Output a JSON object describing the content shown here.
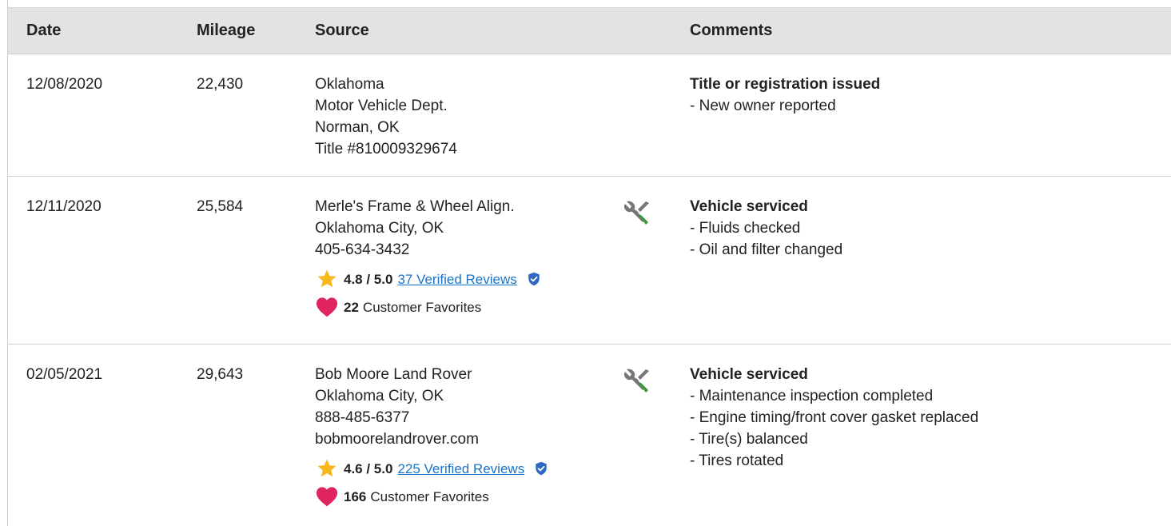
{
  "header": {
    "date": "Date",
    "mileage": "Mileage",
    "source": "Source",
    "comments": "Comments"
  },
  "rows": [
    {
      "date": "12/08/2020",
      "mileage": "22,430",
      "source": [
        "Oklahoma",
        "Motor Vehicle Dept.",
        "Norman, OK",
        "Title #810009329674"
      ],
      "comment_title": "Title or registration issued",
      "comments": [
        "- New owner reported"
      ]
    },
    {
      "date": "12/11/2020",
      "mileage": "25,584",
      "source": [
        "Merle's Frame & Wheel Align.",
        "Oklahoma City, OK",
        "405-634-3432"
      ],
      "rating": {
        "score": "4.8 / 5.0",
        "reviews_link": "37 Verified Reviews"
      },
      "favorites": {
        "count": "22",
        "label": "Customer Favorites"
      },
      "service_icon": "wrench-screwdriver-icon",
      "comment_title": "Vehicle serviced",
      "comments": [
        "- Fluids checked",
        "- Oil and filter changed"
      ]
    },
    {
      "date": "02/05/2021",
      "mileage": "29,643",
      "source": [
        "Bob Moore Land Rover",
        "Oklahoma City, OK",
        "888-485-6377",
        "bobmoorelandrover.com"
      ],
      "rating": {
        "score": "4.6 / 5.0",
        "reviews_link": "225 Verified Reviews"
      },
      "favorites": {
        "count": "166",
        "label": "Customer Favorites"
      },
      "service_icon": "wrench-screwdriver-icon",
      "comment_title": "Vehicle serviced",
      "comments": [
        "- Maintenance inspection completed",
        "- Engine timing/front cover gasket replaced",
        "- Tire(s) balanced",
        "- Tires rotated"
      ]
    }
  ],
  "colors": {
    "header_bg": "#e3e3e3",
    "link": "#1a73c9",
    "star": "#f6b81a",
    "heart": "#e0245e",
    "verified": "#2f67c4",
    "wrench_gray": "#777777",
    "screwdriver_green": "#3a9a3a"
  }
}
